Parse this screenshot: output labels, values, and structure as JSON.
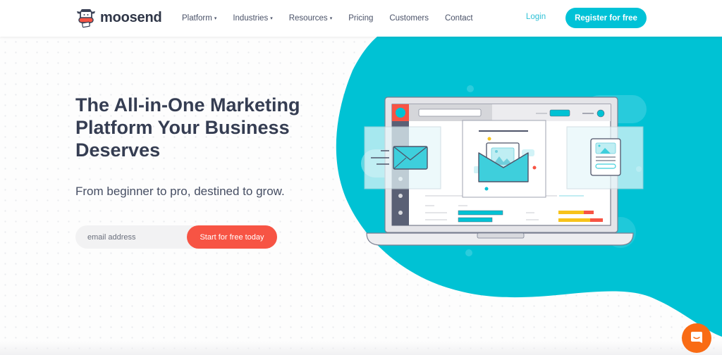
{
  "brand": {
    "name": "moosend",
    "logo_icon": "cow-head-icon"
  },
  "nav": {
    "items": [
      {
        "label": "Platform",
        "dropdown": true
      },
      {
        "label": "Industries",
        "dropdown": true
      },
      {
        "label": "Resources",
        "dropdown": true
      },
      {
        "label": "Pricing",
        "dropdown": false
      },
      {
        "label": "Customers",
        "dropdown": false
      },
      {
        "label": "Contact",
        "dropdown": false
      }
    ],
    "caret": "▾",
    "login_label": "Login",
    "register_label": "Register for free"
  },
  "hero": {
    "headline": "The All-in-One Marketing Platform Your Business Deserves",
    "subheadline": "From beginner to pro, destined to grow.",
    "email_placeholder": "email address",
    "email_value": "",
    "cta_label": "Start for free today"
  },
  "chat_widget": {
    "icon": "chat-bubble-icon"
  },
  "colors": {
    "brand_teal": "#00c2d7",
    "cta_red": "#f75444",
    "heading_text": "#353d52",
    "chat_orange": "#f96b14",
    "accent_yellow": "#f7c31a"
  }
}
